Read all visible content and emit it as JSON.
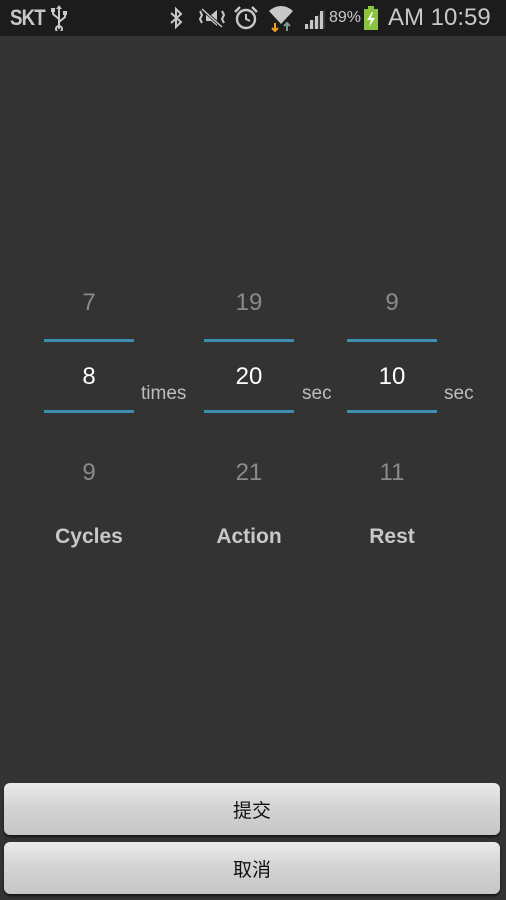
{
  "status_bar": {
    "carrier": "SKT",
    "usb_icon": "usb-icon",
    "bluetooth_icon": "bluetooth-icon",
    "mute_icon": "vibrate-mute-icon",
    "alarm_icon": "alarm-icon",
    "wifi_icon": "wifi-icon",
    "signal_icon": "signal-icon",
    "battery_percent": "89%",
    "battery_icon": "battery-charging-icon",
    "battery_color": "#8bc53f",
    "time": "AM 10:59"
  },
  "pickers": [
    {
      "id": "cycles",
      "prev": "7",
      "current": "8",
      "next": "9",
      "unit": "times",
      "caption": "Cycles"
    },
    {
      "id": "action",
      "prev": "19",
      "current": "20",
      "next": "21",
      "unit": "sec",
      "caption": "Action"
    },
    {
      "id": "rest",
      "prev": "9",
      "current": "10",
      "next": "11",
      "unit": "sec",
      "caption": "Rest"
    }
  ],
  "accent_color": "#3a8fb0",
  "buttons": {
    "submit_label": "提交",
    "cancel_label": "取消"
  }
}
